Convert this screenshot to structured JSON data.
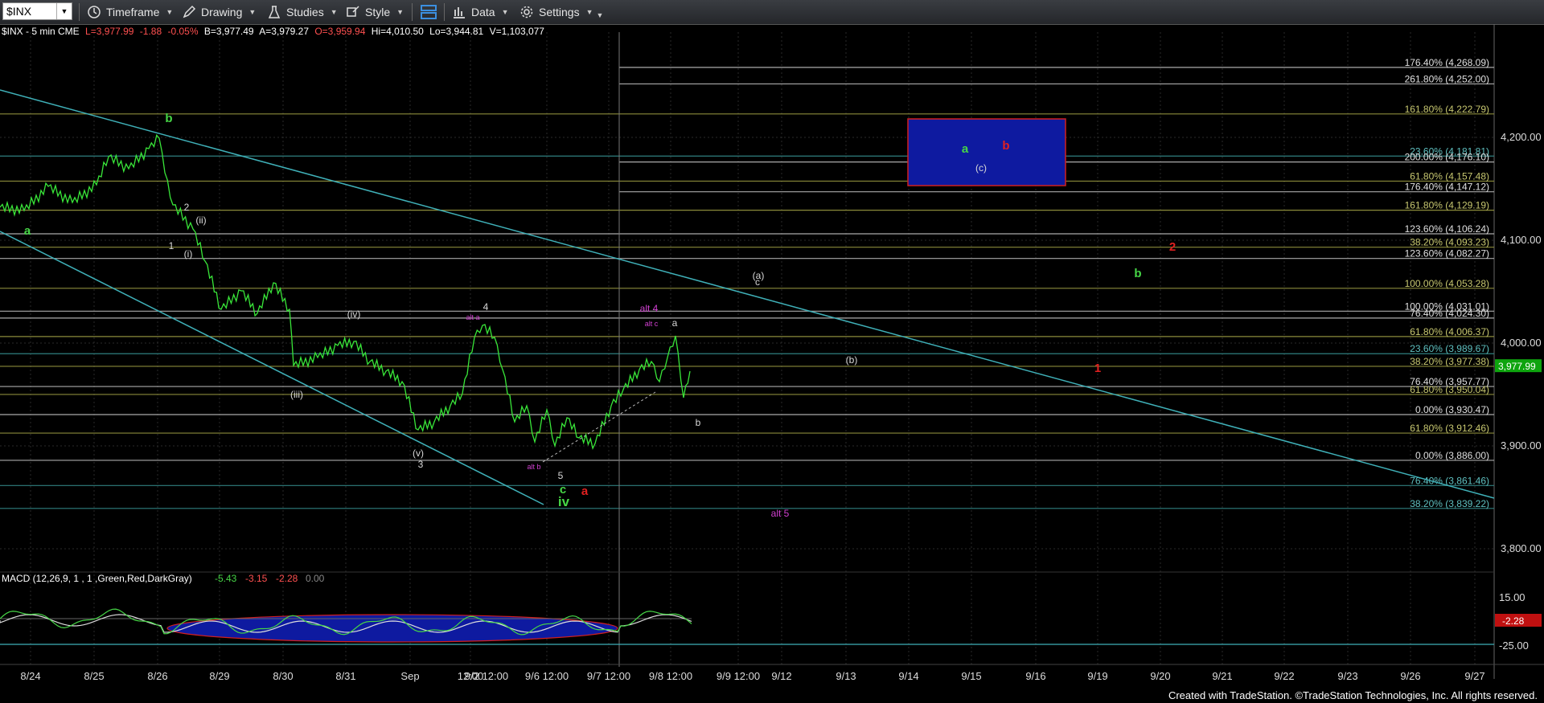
{
  "toolbar": {
    "symbol": "$INX",
    "timeframe": "Timeframe",
    "drawing": "Drawing",
    "studies": "Studies",
    "style": "Style",
    "data": "Data",
    "settings": "Settings"
  },
  "info": {
    "name": "$INX - 5 min  CME",
    "last": "L=3,977.99",
    "chg": "-1.88",
    "pct": "-0.05%",
    "bid": "B=3,977.49",
    "ask": "A=3,979.27",
    "open": "O=3,959.94",
    "hi": "Hi=4,010.50",
    "lo": "Lo=3,944.81",
    "vol": "V=1,103,077"
  },
  "colors": {
    "price": "#39e639",
    "grid": "#2a2a2a",
    "trend": "#3fb0b8",
    "fib_white": "#aaaaaa",
    "fib_olive": "#8a8a3a",
    "fib_teal": "#2f7f7f",
    "label_green": "#46d646",
    "label_red": "#e02020",
    "label_magenta": "#d040d0",
    "label_white": "#d8d8d8",
    "box": "#0e1aa0",
    "box_border": "#d02020"
  },
  "chart_data": {
    "type": "line",
    "title": "$INX - 5 min CME",
    "price_axis": [
      "4,200.00",
      "4,100.00",
      "4,000.00",
      "3,900.00",
      "3,800.00"
    ],
    "price_values": [
      4200,
      4100,
      4000,
      3900,
      3800
    ],
    "ylim": [
      3760,
      4300
    ],
    "last_price": "3,977.99",
    "date_axis": [
      "8/24",
      "8/25",
      "8/26",
      "8/29",
      "8/30",
      "8/31",
      "Sep",
      "12:00",
      "9/2 12:00",
      "9/6 12:00",
      "9/7 12:00",
      "9/8 12:00",
      "9/9 12:00",
      "9/12",
      "9/13",
      "9/14",
      "9/15",
      "9/16",
      "9/19",
      "9/20",
      "9/21",
      "9/22",
      "9/23",
      "9/26",
      "9/27"
    ],
    "fib_levels": [
      {
        "label": "176.40% (4,268.09)",
        "value": 4268.09,
        "c": "w"
      },
      {
        "label": "261.80% (4,252.00)",
        "value": 4252.0,
        "c": "w"
      },
      {
        "label": "161.80% (4,222.79)",
        "value": 4222.79,
        "c": "o"
      },
      {
        "label": "23.60% (4,181.81)",
        "value": 4181.81,
        "c": "t"
      },
      {
        "label": "200.00% (4,176.10)",
        "value": 4176.1,
        "c": "w"
      },
      {
        "label": "61.80% (4,157.48)",
        "value": 4157.48,
        "c": "o"
      },
      {
        "label": "176.40% (4,147.12)",
        "value": 4147.12,
        "c": "w"
      },
      {
        "label": "161.80% (4,129.19)",
        "value": 4129.19,
        "c": "o"
      },
      {
        "label": "123.60% (4,106.24)",
        "value": 4106.24,
        "c": "w"
      },
      {
        "label": "38.20% (4,093.23)",
        "value": 4093.23,
        "c": "o"
      },
      {
        "label": "123.60% (4,082.27)",
        "value": 4082.27,
        "c": "w"
      },
      {
        "label": "100.00% (4,053.28)",
        "value": 4053.28,
        "c": "o"
      },
      {
        "label": "100.00% (4,031.01)",
        "value": 4031.01,
        "c": "w"
      },
      {
        "label": "76.40% (4,024.30)",
        "value": 4024.3,
        "c": "w"
      },
      {
        "label": "61.80% (4,006.37)",
        "value": 4006.37,
        "c": "o"
      },
      {
        "label": "23.60% (3,989.67)",
        "value": 3989.67,
        "c": "t"
      },
      {
        "label": "38.20% (3,977.38)",
        "value": 3977.38,
        "c": "o"
      },
      {
        "label": "76.40% (3,957.77)",
        "value": 3957.77,
        "c": "w"
      },
      {
        "label": "61.80% (3,950.04)",
        "value": 3950.04,
        "c": "o"
      },
      {
        "label": "0.00% (3,930.47)",
        "value": 3930.47,
        "c": "w"
      },
      {
        "label": "61.80% (3,912.46)",
        "value": 3912.46,
        "c": "o"
      },
      {
        "label": "0.00% (3,886.00)",
        "value": 3886.0,
        "c": "w"
      },
      {
        "label": "76.40% (3,861.46)",
        "value": 3861.46,
        "c": "t"
      },
      {
        "label": "38.20% (3,839.22)",
        "value": 3839.22,
        "c": "t"
      }
    ],
    "macd": {
      "label": "MACD (12,26,9, 1 , 1 ,Green,Red,DarkGray)",
      "v1": "-5.43",
      "v2": "-3.15",
      "v3": "-2.28",
      "v4": "0.00",
      "axis": [
        "15.00",
        "-25.00"
      ],
      "current": "-2.28"
    }
  },
  "wave_labels": [
    {
      "t": "a",
      "c": "g"
    },
    {
      "t": "b",
      "c": "g"
    },
    {
      "t": "2",
      "c": "w"
    },
    {
      "t": "(ii)",
      "c": "w"
    },
    {
      "t": "1",
      "c": "w"
    },
    {
      "t": "(i)",
      "c": "w"
    },
    {
      "t": "(iv)",
      "c": "w"
    },
    {
      "t": "(iii)",
      "c": "w"
    },
    {
      "t": "(v)",
      "c": "w"
    },
    {
      "t": "3",
      "c": "w"
    },
    {
      "t": "4",
      "c": "w"
    },
    {
      "t": "alt a",
      "c": "m"
    },
    {
      "t": "alt b",
      "c": "m"
    },
    {
      "t": "5",
      "c": "w"
    },
    {
      "t": "c",
      "c": "g"
    },
    {
      "t": "iv",
      "c": "g"
    },
    {
      "t": "a",
      "c": "r"
    },
    {
      "t": "alt 4",
      "c": "m"
    },
    {
      "t": "alt c",
      "c": "m"
    },
    {
      "t": "a",
      "c": "w"
    },
    {
      "t": "b",
      "c": "w"
    },
    {
      "t": "(a)",
      "c": "w"
    },
    {
      "t": "c",
      "c": "w"
    },
    {
      "t": "(b)",
      "c": "w"
    },
    {
      "t": "alt 5",
      "c": "m"
    },
    {
      "t": "a",
      "c": "g"
    },
    {
      "t": "b",
      "c": "r"
    },
    {
      "t": "(c)",
      "c": "w"
    },
    {
      "t": "2",
      "c": "r"
    },
    {
      "t": "b",
      "c": "g"
    },
    {
      "t": "1",
      "c": "r"
    }
  ],
  "credit": "Created with TradeStation. ©TradeStation Technologies, Inc. All rights reserved."
}
